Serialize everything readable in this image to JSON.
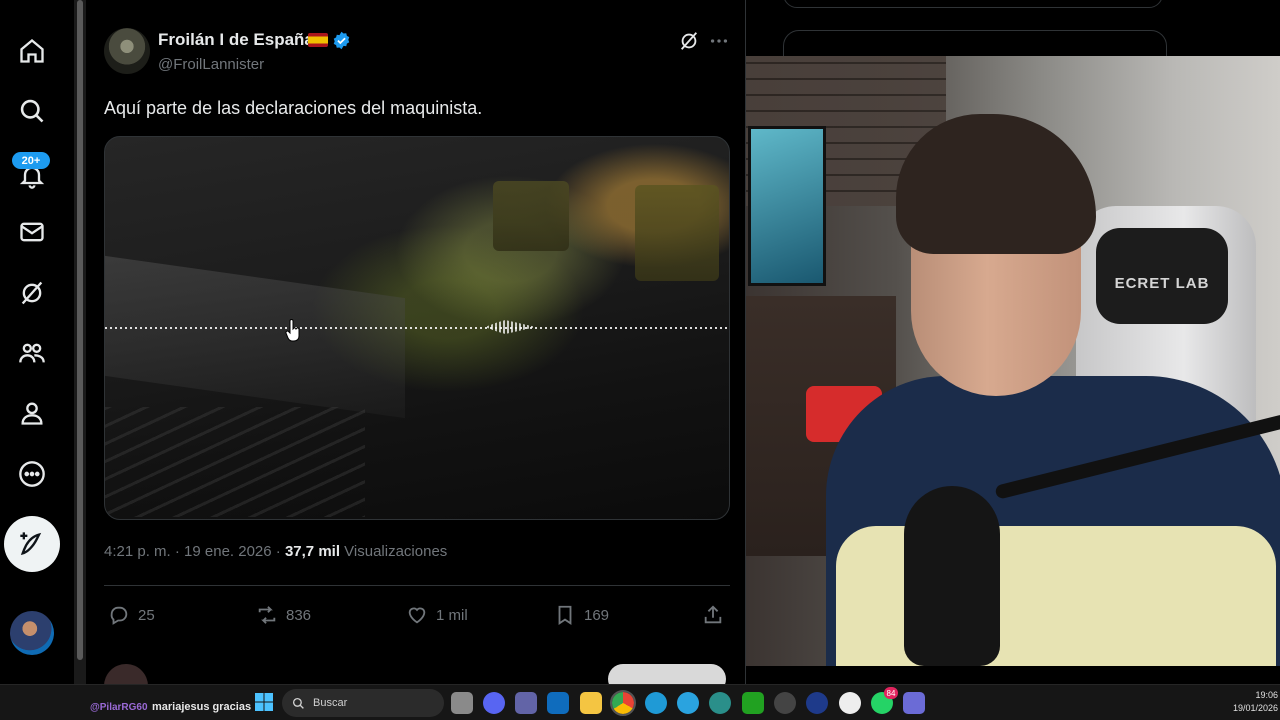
{
  "nav": {
    "notifications_badge": "20+",
    "items": [
      "home-icon",
      "search-icon",
      "notifications-icon",
      "messages-icon",
      "grok-icon",
      "communities-icon",
      "profile-icon",
      "more-icon"
    ],
    "compose_icon": "compose-icon"
  },
  "tweet": {
    "author_name": "Froilán I de España",
    "handle": "@FroilLannister",
    "text": "Aquí parte de las declaraciones del maquinista.",
    "timestamp": "4:21 p. m. · 19 ene. 2026 · ",
    "views_count": "37,7 mil",
    "views_label": " Visualizaciones",
    "replies": "25",
    "reposts": "836",
    "likes": "1 mil",
    "bookmarks": "169"
  },
  "webcam": {
    "chair_logo": "ECRET LAB"
  },
  "taskbar": {
    "chat_user": "@PilarRG60",
    "chat_message": "mariajesus gracias",
    "search_placeholder": "Buscar",
    "whatsapp_badge": "84",
    "clock_time": "19:06",
    "clock_date": "19/01/2026"
  },
  "colors": {
    "accent": "#1d9bf0",
    "background": "#000000",
    "muted_text": "#71767b"
  }
}
